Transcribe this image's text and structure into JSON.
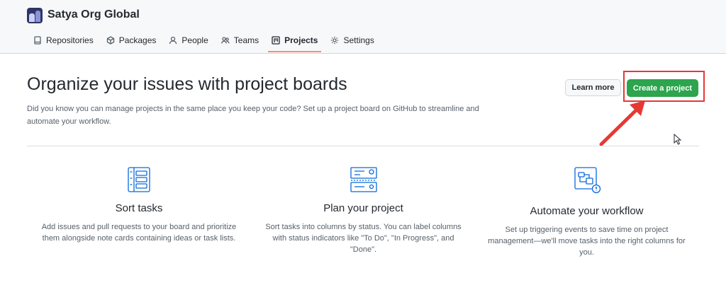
{
  "org": {
    "name": "Satya Org Global"
  },
  "tabs": [
    {
      "label": "Repositories",
      "icon": "repo-icon"
    },
    {
      "label": "Packages",
      "icon": "package-icon"
    },
    {
      "label": "People",
      "icon": "person-icon"
    },
    {
      "label": "Teams",
      "icon": "people-icon"
    },
    {
      "label": "Projects",
      "icon": "project-icon",
      "active": true
    },
    {
      "label": "Settings",
      "icon": "gear-icon"
    }
  ],
  "main": {
    "title": "Organize your issues with project boards",
    "description": "Did you know you can manage projects in the same place you keep your code? Set up a project board on GitHub to streamline and automate your workflow.",
    "learn_more_label": "Learn more",
    "create_label": "Create a project"
  },
  "features": [
    {
      "icon": "sort-tasks-icon",
      "title": "Sort tasks",
      "description": "Add issues and pull requests to your board and prioritize them alongside note cards containing ideas or task lists."
    },
    {
      "icon": "plan-project-icon",
      "title": "Plan your project",
      "description": "Sort tasks into columns by status. You can label columns with status indicators like \"To Do\", \"In Progress\", and \"Done\"."
    },
    {
      "icon": "automate-workflow-icon",
      "title": "Automate your workflow",
      "description": "Set up triggering events to save time on project management—we'll move tasks into the right columns for you."
    }
  ],
  "colors": {
    "primary_button": "#2da44e",
    "active_tab_underline": "#fd8c73",
    "annotation": "#e53935",
    "feature_icon": "#0969da"
  }
}
